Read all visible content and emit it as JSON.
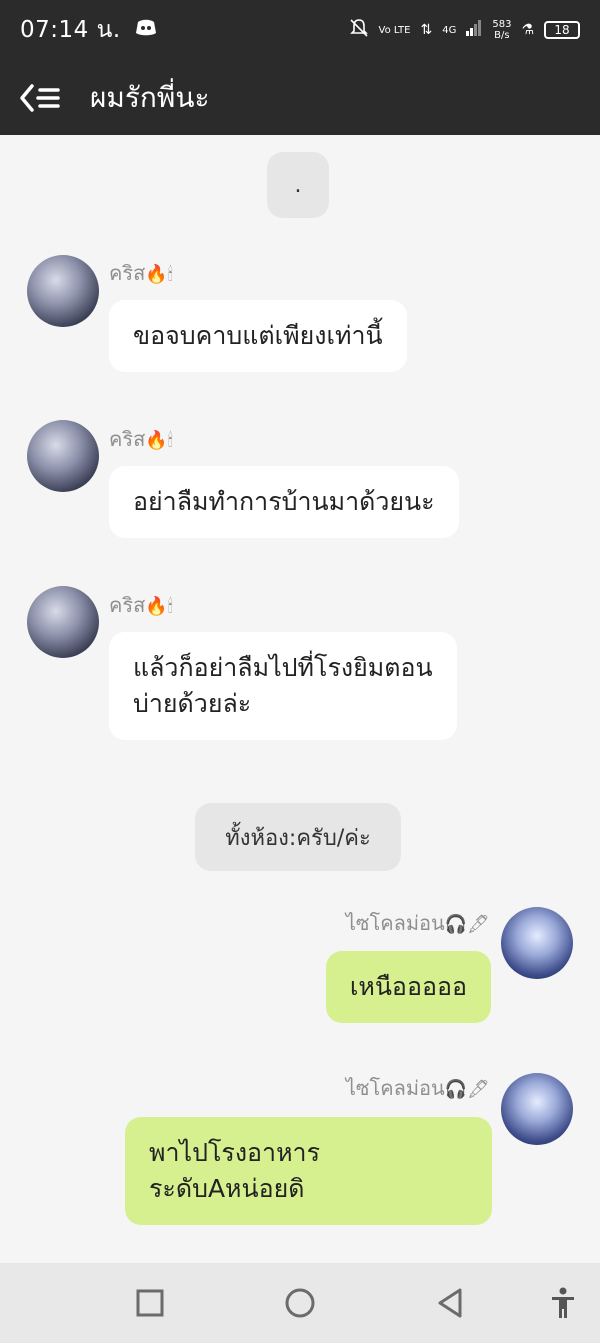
{
  "status": {
    "time": "07:14 น.",
    "volte": "Vo LTE",
    "network": "4G",
    "speed_value": "583",
    "speed_unit": "B/s",
    "battery": "18"
  },
  "header": {
    "title": "ผมรักพี่นะ"
  },
  "chat": {
    "top_pill": ".",
    "messages_left": [
      {
        "sender": "คริส",
        "sender_emoji": "🔥🕯",
        "text_lines": [
          "ขอจบคาบแต่เพียงเท่านี้"
        ]
      },
      {
        "sender": "คริส",
        "sender_emoji": "🔥🕯",
        "text_lines": [
          "อย่าลืมทำการบ้านมาด้วยนะ"
        ]
      },
      {
        "sender": "คริส",
        "sender_emoji": "🔥🕯",
        "text_lines": [
          "แล้วก็อย่าลืมไปที่โรงยิมตอน",
          "บ่ายด้วยล่ะ"
        ]
      }
    ],
    "middle_pill": "ทั้งห้อง:ครับ/ค่ะ",
    "messages_right": [
      {
        "sender": "ไซโคลม่อน",
        "sender_emoji": "🎧🖋",
        "text_lines": [
          "เหนือออออ"
        ]
      },
      {
        "sender": "ไซโคลม่อน",
        "sender_emoji": "🎧🖋",
        "text_lines": [
          "พาไปโรงอาหาร",
          "ระดับAหน่อยดิ"
        ]
      }
    ]
  },
  "nav": {
    "icons": [
      "recent-apps-icon",
      "home-icon",
      "back-icon",
      "accessibility-icon"
    ]
  }
}
